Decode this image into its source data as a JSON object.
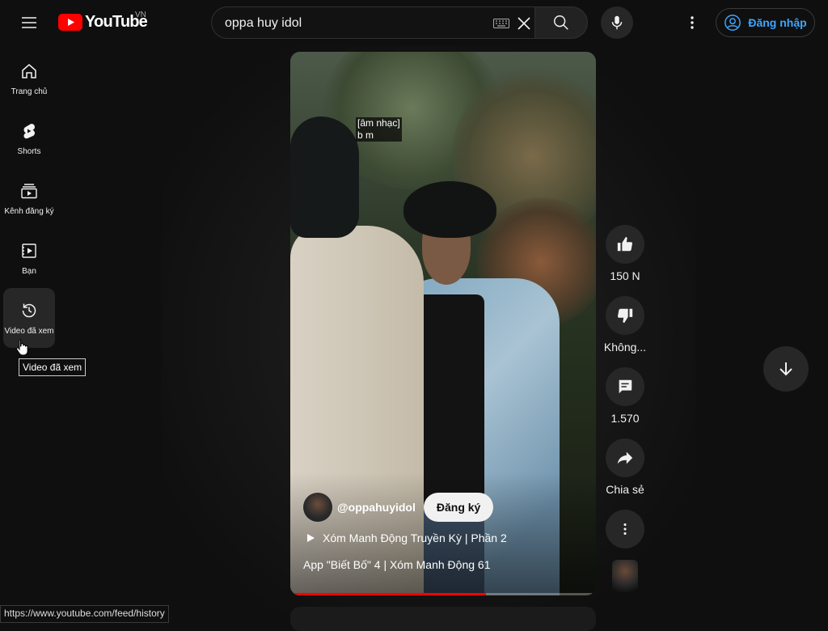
{
  "app": {
    "logo_text": "YouTube",
    "country_code": "VN"
  },
  "search": {
    "query": "oppa huy idol"
  },
  "header": {
    "signin_label": "Đăng nhập"
  },
  "sidebar": {
    "items": [
      {
        "label": "Trang chủ",
        "icon": "home-icon"
      },
      {
        "label": "Shorts",
        "icon": "shorts-icon"
      },
      {
        "label": "Kênh đăng ký",
        "icon": "subscriptions-icon"
      },
      {
        "label": "Bạn",
        "icon": "you-icon"
      },
      {
        "label": "Video đã xem",
        "icon": "history-icon"
      }
    ],
    "hovered_index": 4,
    "tooltip": "Video đã xem"
  },
  "video": {
    "caption_line1": "[âm nhạc]",
    "caption_line2": "b m",
    "channel": "@oppahuyidol",
    "subscribe_label": "Đăng ký",
    "playlist": "Xóm Manh Động Truyền Kỳ | Phần 2",
    "title": "App \"Biết Bố\" 4 | Xóm Manh Động 61",
    "progress": 0.64
  },
  "actions": {
    "like_count": "150 N",
    "dislike_label": "Không...",
    "comment_count": "1.570",
    "share_label": "Chia sẻ"
  },
  "colors": {
    "accent": "#3ea6ff",
    "brand_red": "#ff0000",
    "background": "#0f0f0f"
  },
  "status_url": "https://www.youtube.com/feed/history"
}
